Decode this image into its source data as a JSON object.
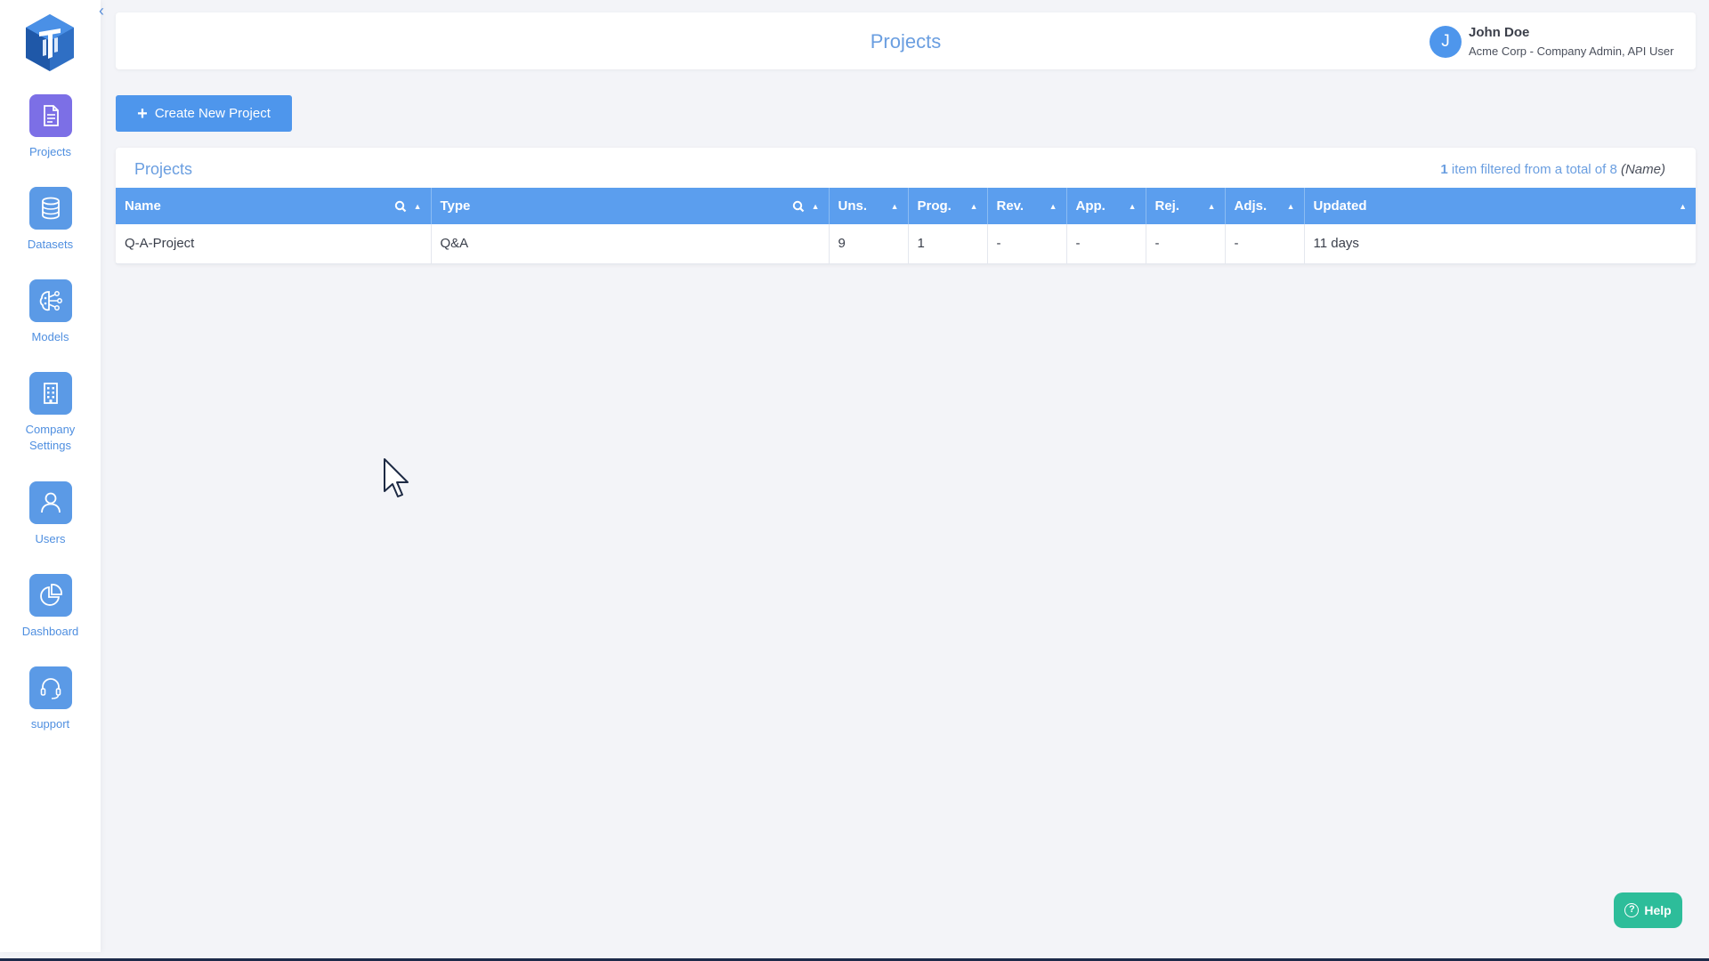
{
  "header": {
    "title": "Projects",
    "user": {
      "avatar_letter": "J",
      "name": "John Doe",
      "role": "Acme Corp - Company Admin, API User"
    }
  },
  "sidebar": {
    "collapse_icon": "chevron-left-icon",
    "items": [
      {
        "label": "Projects",
        "icon": "document-icon",
        "active": true
      },
      {
        "label": "Datasets",
        "icon": "database-icon"
      },
      {
        "label": "Models",
        "icon": "brain-network-icon"
      },
      {
        "label": "Company\nSettings",
        "icon": "building-icon"
      },
      {
        "label": "Users",
        "icon": "user-icon"
      },
      {
        "label": "Dashboard",
        "icon": "pie-chart-icon"
      },
      {
        "label": "support",
        "icon": "headset-icon"
      }
    ]
  },
  "toolbar": {
    "create_label": "Create New Project"
  },
  "panel": {
    "title": "Projects",
    "filter_count": "1",
    "filter_text": " item filtered from a total of 8 ",
    "filter_field": "(Name)"
  },
  "table": {
    "columns": [
      "Name",
      "Type",
      "Uns.",
      "Prog.",
      "Rev.",
      "App.",
      "Rej.",
      "Adjs.",
      "Updated"
    ],
    "rows": [
      [
        "Q-A-Project",
        "Q&A",
        "9",
        "1",
        "-",
        "-",
        "-",
        "-",
        "11 days"
      ]
    ]
  },
  "help": {
    "label": "Help"
  },
  "colors": {
    "accent": "#4e96ec",
    "active_nav": "#7c6fe6",
    "table_header": "#5b9eee",
    "help": "#2dbd9a"
  }
}
